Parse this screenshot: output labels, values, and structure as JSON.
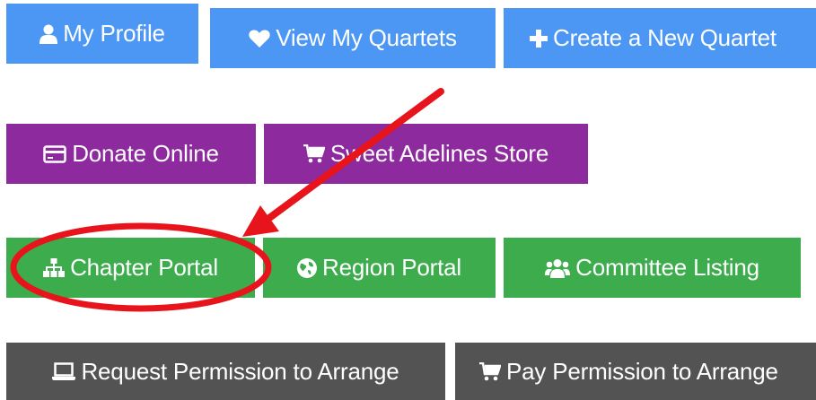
{
  "row1": {
    "my_profile": "My Profile",
    "view_quartets": "View My Quartets",
    "create_quartet": "Create a New Quartet"
  },
  "row2": {
    "donate": "Donate Online",
    "store": "Sweet Adelines Store"
  },
  "row3": {
    "chapter_portal": "Chapter Portal",
    "region_portal": "Region Portal",
    "committee_listing": "Committee Listing"
  },
  "row4": {
    "request_permission": "Request Permission to Arrange",
    "pay_permission": "Pay Permission to Arrange"
  },
  "colors": {
    "blue": "#4c97f4",
    "purple": "#8c2a9e",
    "green": "#3cac4c",
    "gray": "#535353",
    "annotation_red": "#e8141c"
  },
  "icons": {
    "my_profile": "user-icon",
    "view_quartets": "heart-icon",
    "create_quartet": "plus-icon",
    "donate": "credit-card-icon",
    "store": "shopping-cart-icon",
    "chapter_portal": "sitemap-icon",
    "region_portal": "globe-icon",
    "committee_listing": "users-icon",
    "request_permission": "laptop-icon",
    "pay_permission": "shopping-cart-icon"
  }
}
